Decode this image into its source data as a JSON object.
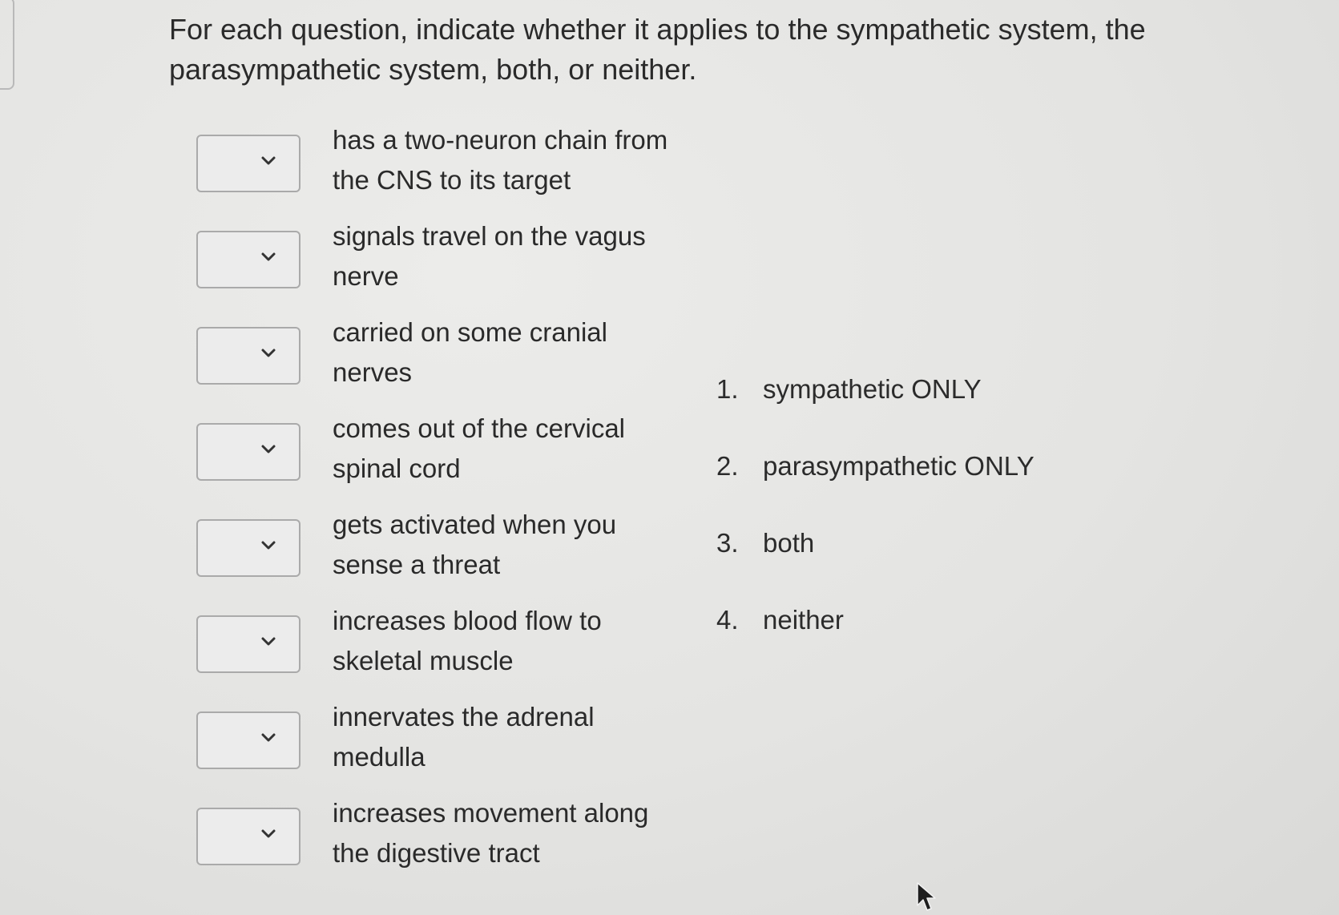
{
  "question": "For each question, indicate whether it applies to the sympathetic system, the parasympathetic system, both, or neither.",
  "items": [
    {
      "statement": "has a two-neuron chain from the CNS to its target",
      "selected": ""
    },
    {
      "statement": "signals travel on the vagus nerve",
      "selected": ""
    },
    {
      "statement": "carried on some cranial nerves",
      "selected": ""
    },
    {
      "statement": "comes out of the cervical spinal cord",
      "selected": ""
    },
    {
      "statement": "gets activated when you sense a threat",
      "selected": ""
    },
    {
      "statement": "increases blood flow to skeletal muscle",
      "selected": ""
    },
    {
      "statement": "innervates the adrenal medulla",
      "selected": ""
    },
    {
      "statement": "increases movement along the digestive tract",
      "selected": ""
    }
  ],
  "options": [
    {
      "number": "1.",
      "label": "sympathetic ONLY"
    },
    {
      "number": "2.",
      "label": "parasympathetic ONLY"
    },
    {
      "number": "3.",
      "label": "both"
    },
    {
      "number": "4.",
      "label": "neither"
    }
  ],
  "icons": {
    "dropdown": "chevron-down-icon",
    "pointer": "cursor-arrow-icon"
  },
  "colors": {
    "background": "#e6e6e4",
    "text": "#2a2a2a",
    "select_border": "#aaaaaa"
  }
}
